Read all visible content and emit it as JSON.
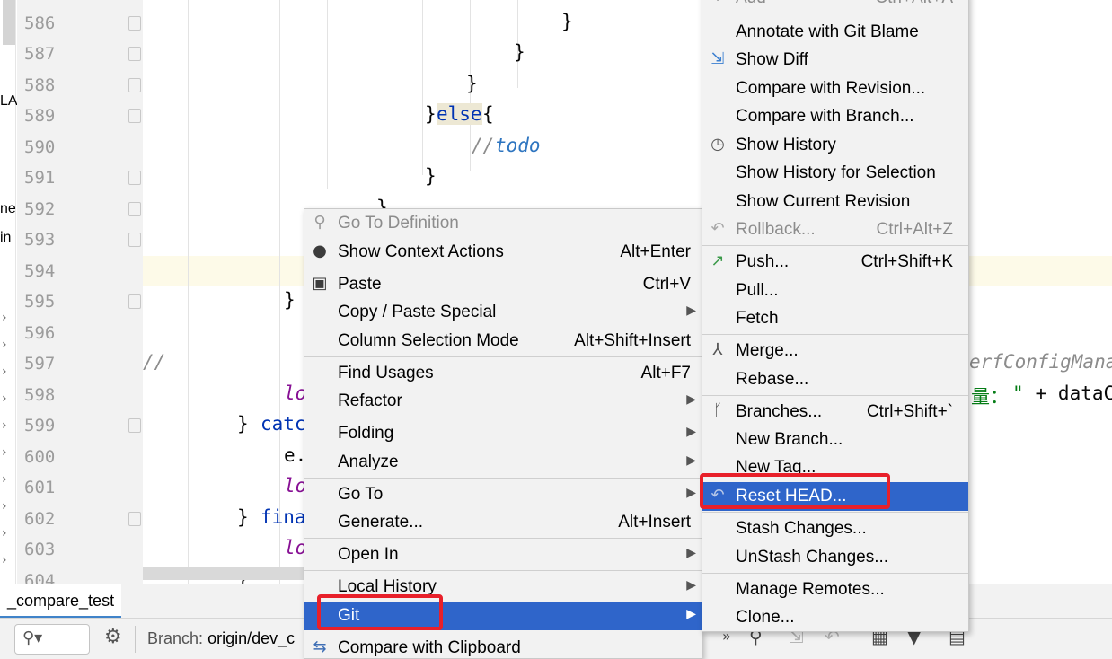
{
  "editor": {
    "line_numbers": [
      "586",
      "587",
      "588",
      "589",
      "590",
      "591",
      "592",
      "593",
      "594",
      "595",
      "596",
      "597",
      "598",
      "599",
      "600",
      "601",
      "602",
      "603",
      "604"
    ],
    "code": {
      "brace_586": "}",
      "brace_587": "}",
      "brace_588": "}",
      "else_open": "}",
      "else_kw": "else",
      "else_brace": "{",
      "todo_slashes": "//",
      "todo_text": "todo",
      "brace_591": "}",
      "brace_592": "}",
      "brace_595": "}",
      "comment_597": "//",
      "right_597": "erfConfigMana",
      "lo_598": "lo",
      "right_598_label": "量：",
      "right_598_str": "\"",
      "right_598_rest": " + dataC",
      "catch_brace": "} ",
      "catch_kw": "catc",
      "e_600": "e.",
      "lo_601": "lo",
      "finally_brace": "} ",
      "finally_kw": "fina",
      "lo_603": "lo",
      "brace_604": "}"
    }
  },
  "left_strip": {
    "label_la": "LA",
    "label_ne": "ne",
    "label_in": "in"
  },
  "bottom_panel": {
    "tab_label": "_compare_test",
    "branch_key": "Branch:",
    "branch_value": "origin/dev_c"
  },
  "main_menu": {
    "items": [
      {
        "label": "Go To Definition",
        "shortcut": "",
        "icon": "search-icon",
        "disabled": true
      },
      {
        "label": "Show Context Actions",
        "shortcut": "Alt+Enter",
        "icon": "bulb-icon"
      },
      {
        "label": "Paste",
        "shortcut": "Ctrl+V",
        "icon": "clipboard-icon"
      },
      {
        "label": "Copy / Paste Special",
        "shortcut": "",
        "submenu": true
      },
      {
        "label": "Column Selection Mode",
        "shortcut": "Alt+Shift+Insert"
      },
      {
        "label": "Find Usages",
        "shortcut": "Alt+F7"
      },
      {
        "label": "Refactor",
        "shortcut": "",
        "submenu": true
      },
      {
        "label": "Folding",
        "shortcut": "",
        "submenu": true
      },
      {
        "label": "Analyze",
        "shortcut": "",
        "submenu": true
      },
      {
        "label": "Go To",
        "shortcut": "",
        "submenu": true
      },
      {
        "label": "Generate...",
        "shortcut": "Alt+Insert"
      },
      {
        "label": "Open In",
        "shortcut": "",
        "submenu": true
      },
      {
        "label": "Local History",
        "shortcut": "",
        "submenu": true
      },
      {
        "label": "Git",
        "shortcut": "",
        "submenu": true,
        "selected": true
      },
      {
        "label": "Compare with Clipboard",
        "shortcut": "",
        "icon": "compare-clipboard-icon"
      }
    ]
  },
  "git_menu": {
    "items": [
      {
        "label": "Add",
        "shortcut": "Ctrl+Alt+A",
        "icon": "plus-icon",
        "disabled": true
      },
      {
        "label": "Annotate with Git Blame",
        "shortcut": ""
      },
      {
        "label": "Show Diff",
        "shortcut": "",
        "icon": "diff-arrows-icon"
      },
      {
        "label": "Compare with Revision...",
        "shortcut": ""
      },
      {
        "label": "Compare with Branch...",
        "shortcut": ""
      },
      {
        "label": "Show History",
        "shortcut": "",
        "icon": "clock-icon"
      },
      {
        "label": "Show History for Selection",
        "shortcut": ""
      },
      {
        "label": "Show Current Revision",
        "shortcut": ""
      },
      {
        "label": "Rollback...",
        "shortcut": "Ctrl+Alt+Z",
        "icon": "undo-icon",
        "disabled": true
      },
      {
        "label": "Push...",
        "shortcut": "Ctrl+Shift+K",
        "icon": "push-arrow-icon"
      },
      {
        "label": "Pull...",
        "shortcut": ""
      },
      {
        "label": "Fetch",
        "shortcut": ""
      },
      {
        "label": "Merge...",
        "shortcut": "",
        "icon": "merge-icon"
      },
      {
        "label": "Rebase...",
        "shortcut": ""
      },
      {
        "label": "Branches...",
        "shortcut": "Ctrl+Shift+`",
        "icon": "branch-icon"
      },
      {
        "label": "New Branch...",
        "shortcut": ""
      },
      {
        "label": "New Tag...",
        "shortcut": ""
      },
      {
        "label": "Reset HEAD...",
        "shortcut": "",
        "icon": "reset-icon",
        "selected": true
      },
      {
        "label": "Stash Changes...",
        "shortcut": ""
      },
      {
        "label": "UnStash Changes...",
        "shortcut": ""
      },
      {
        "label": "Manage Remotes...",
        "shortcut": ""
      },
      {
        "label": "Clone...",
        "shortcut": ""
      }
    ]
  },
  "colors": {
    "selection": "#2f65ca",
    "highlight_box": "#e8202a",
    "keyword": "#0033b3"
  }
}
